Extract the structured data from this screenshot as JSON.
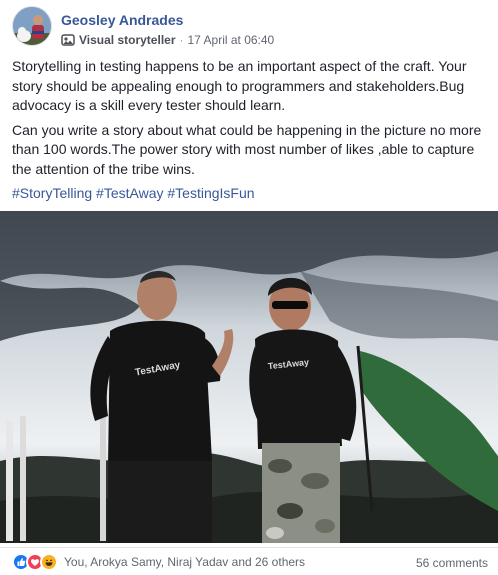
{
  "post": {
    "author": "Geosley Andrades",
    "badge": "Visual storyteller",
    "separator": "·",
    "timestamp": "17 April at 06:40",
    "paragraphs": [
      "Storytelling in testing happens to be an important aspect of the craft. Your story should be appealing enough to programmers and stakeholders.Bug advocacy is a skill every tester should learn.",
      "Can you write a story about what could be happening in the picture no more than 100 words.The power story with most number of likes ,able to capture the attention of the tribe wins."
    ],
    "hashtags": [
      "#StoryTelling",
      "#TestAway",
      "#TestingIsFun"
    ],
    "image": {
      "shirt_text_left": "TestAway",
      "shirt_text_right": "TestAway"
    }
  },
  "footer": {
    "reaction_icons": [
      "like-icon",
      "love-icon",
      "haha-icon"
    ],
    "reactors": "You, Arokya Samy, Niraj Yadav and 26 others",
    "comments": "56 comments"
  },
  "colors": {
    "link": "#385898",
    "text": "#1d2129",
    "meta": "#616770",
    "like": "#1877f2",
    "love": "#f33e58",
    "haha": "#f7b125"
  }
}
